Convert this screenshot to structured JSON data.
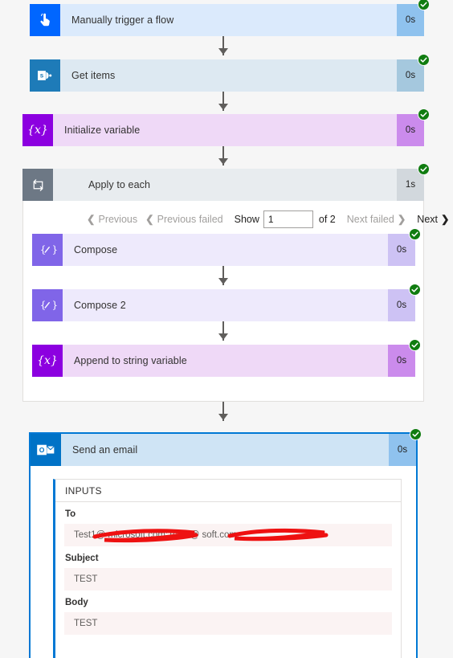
{
  "flow": {
    "steps": [
      {
        "id": "manual-trigger",
        "title": "Manually trigger a flow",
        "duration": "0s",
        "status": "succeeded",
        "icon": "hand-tap-icon",
        "icon_bg": "#0066ff",
        "body_bg": "#dbeafc",
        "dur_bg": "#8fc2ee"
      },
      {
        "id": "get-items",
        "title": "Get items",
        "duration": "0s",
        "status": "succeeded",
        "icon": "sharepoint-icon",
        "icon_bg": "#1e7bb8",
        "body_bg": "#dde9f2",
        "dur_bg": "#a5c8de"
      },
      {
        "id": "initialize-variable",
        "title": "Initialize variable",
        "duration": "0s",
        "status": "succeeded",
        "icon": "variable-braces-icon",
        "icon_bg": "#8c00e0",
        "body_bg": "#efd9f7",
        "dur_bg": "#cb8bec"
      }
    ],
    "scope": {
      "id": "apply-to-each",
      "title": "Apply to each",
      "duration": "1s",
      "status": "succeeded",
      "icon": "loop-repeat-icon",
      "icon_bg": "#6d7885",
      "body_bg": "#e8ecef",
      "dur_bg": "#d2d8dd",
      "pagination": {
        "previous": "Previous",
        "previous_failed": "Previous failed",
        "show_label": "Show",
        "page_value": "1",
        "of_label": "of 2",
        "next_failed": "Next failed",
        "next": "Next"
      },
      "steps": [
        {
          "id": "compose",
          "title": "Compose",
          "duration": "0s",
          "status": "succeeded",
          "icon": "compose-pencil-icon",
          "icon_bg": "#8065e8",
          "body_bg": "#eeeafc",
          "dur_bg": "#cdc2f4"
        },
        {
          "id": "compose-2",
          "title": "Compose 2",
          "duration": "0s",
          "status": "succeeded",
          "icon": "compose-pencil-icon",
          "icon_bg": "#8065e8",
          "body_bg": "#eeeafc",
          "dur_bg": "#cdc2f4"
        },
        {
          "id": "append-to-string-variable",
          "title": "Append to string variable",
          "duration": "0s",
          "status": "succeeded",
          "icon": "variable-braces-icon",
          "icon_bg": "#8c00e0",
          "body_bg": "#efd9f7",
          "dur_bg": "#cb8bec"
        }
      ]
    },
    "email": {
      "id": "send-an-email",
      "title": "Send an email",
      "duration": "0s",
      "status": "succeeded",
      "icon": "outlook-icon",
      "icon_bg": "#0072c6",
      "body_bg": "#cfe4f5",
      "dur_bg": "#8fc2ee",
      "inputs_header": "INPUTS",
      "fields": [
        {
          "label": "To",
          "value": "Test1@          microsoft.com;Test2@               soft.com;;",
          "redacted": true
        },
        {
          "label": "Subject",
          "value": "TEST",
          "redacted": false
        },
        {
          "label": "Body",
          "value": "TEST",
          "redacted": false
        }
      ]
    }
  },
  "theme": {
    "status_color": "#107c10",
    "connector_color": "#605e5c",
    "page_bg": "#f6f6f6",
    "accent": "#0078d4"
  }
}
